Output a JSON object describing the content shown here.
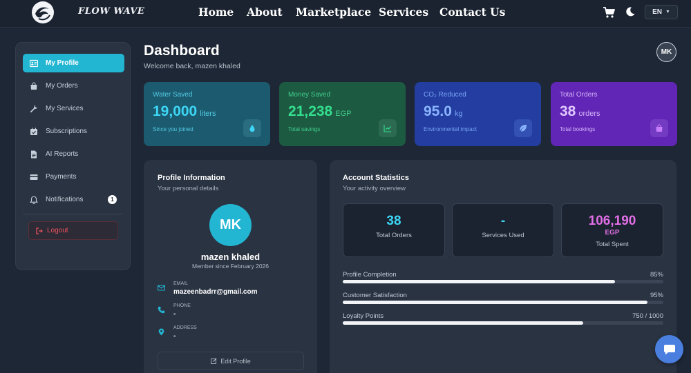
{
  "brand": {
    "name": "FLOW WAVE"
  },
  "nav": {
    "home": "Home",
    "about": "About",
    "marketplace": "Marketplace",
    "services": "Services",
    "contact": "Contact Us",
    "language": "EN"
  },
  "sidebar": {
    "items": [
      {
        "label": "My Profile",
        "icon": "id-card-icon",
        "active": true
      },
      {
        "label": "My Orders",
        "icon": "shopping-bag-icon"
      },
      {
        "label": "My Services",
        "icon": "wrench-icon"
      },
      {
        "label": "Subscriptions",
        "icon": "calendar-check-icon"
      },
      {
        "label": "AI Reports",
        "icon": "document-icon"
      },
      {
        "label": "Payments",
        "icon": "credit-card-icon"
      },
      {
        "label": "Notifications",
        "icon": "bell-icon",
        "badge": "1"
      }
    ],
    "logout": "Logout"
  },
  "header": {
    "title": "Dashboard",
    "subtitle": "Welcome back, mazen khaled",
    "avatar_initials": "MK"
  },
  "stats": {
    "water": {
      "label": "Water Saved",
      "value": "19,000",
      "unit": "liters",
      "note": "Since you joined",
      "icon": "water-drop-icon"
    },
    "money": {
      "label": "Money Saved",
      "value": "21,238",
      "unit": "EGP",
      "note": "Total savings",
      "icon": "chart-line-icon"
    },
    "co2": {
      "label": "CO₂ Reduced",
      "value": "95.0",
      "unit": "kg",
      "note": "Environmental impact",
      "icon": "leaf-icon"
    },
    "orders": {
      "label": "Total Orders",
      "value": "38",
      "unit": "orders",
      "note": "Total bookings",
      "icon": "shopping-bag-icon"
    }
  },
  "profile": {
    "title": "Profile Information",
    "subtitle": "Your personal details",
    "initials": "MK",
    "name": "mazen khaled",
    "since": "Member since February 2026",
    "email_label": "EMAIL",
    "email": "mazeenbadrr@gmail.com",
    "phone_label": "PHONE",
    "phone": "-",
    "address_label": "ADDRESS",
    "address": "-",
    "edit_label": "Edit Profile"
  },
  "account": {
    "title": "Account Statistics",
    "subtitle": "Your activity overview",
    "total_orders_value": "38",
    "total_orders_label": "Total Orders",
    "services_used_value": "-",
    "services_used_label": "Services Used",
    "total_spent_value": "106,190",
    "total_spent_currency": "EGP",
    "total_spent_label": "Total Spent",
    "progress": [
      {
        "label": "Profile Completion",
        "display": "85%",
        "fraction": 0.85
      },
      {
        "label": "Customer Satisfaction",
        "display": "95%",
        "fraction": 0.95
      },
      {
        "label": "Loyalty Points",
        "display": "750 / 1000",
        "fraction": 0.75
      }
    ]
  },
  "colors": {
    "accent": "#22b6d3",
    "water": "#1c5b6f",
    "money": "#1d5a42",
    "co2": "#233ea0",
    "orders": "#6226b6",
    "spent": "#e26ee6",
    "logout": "#f0525e",
    "chat": "#4a7fe0"
  }
}
